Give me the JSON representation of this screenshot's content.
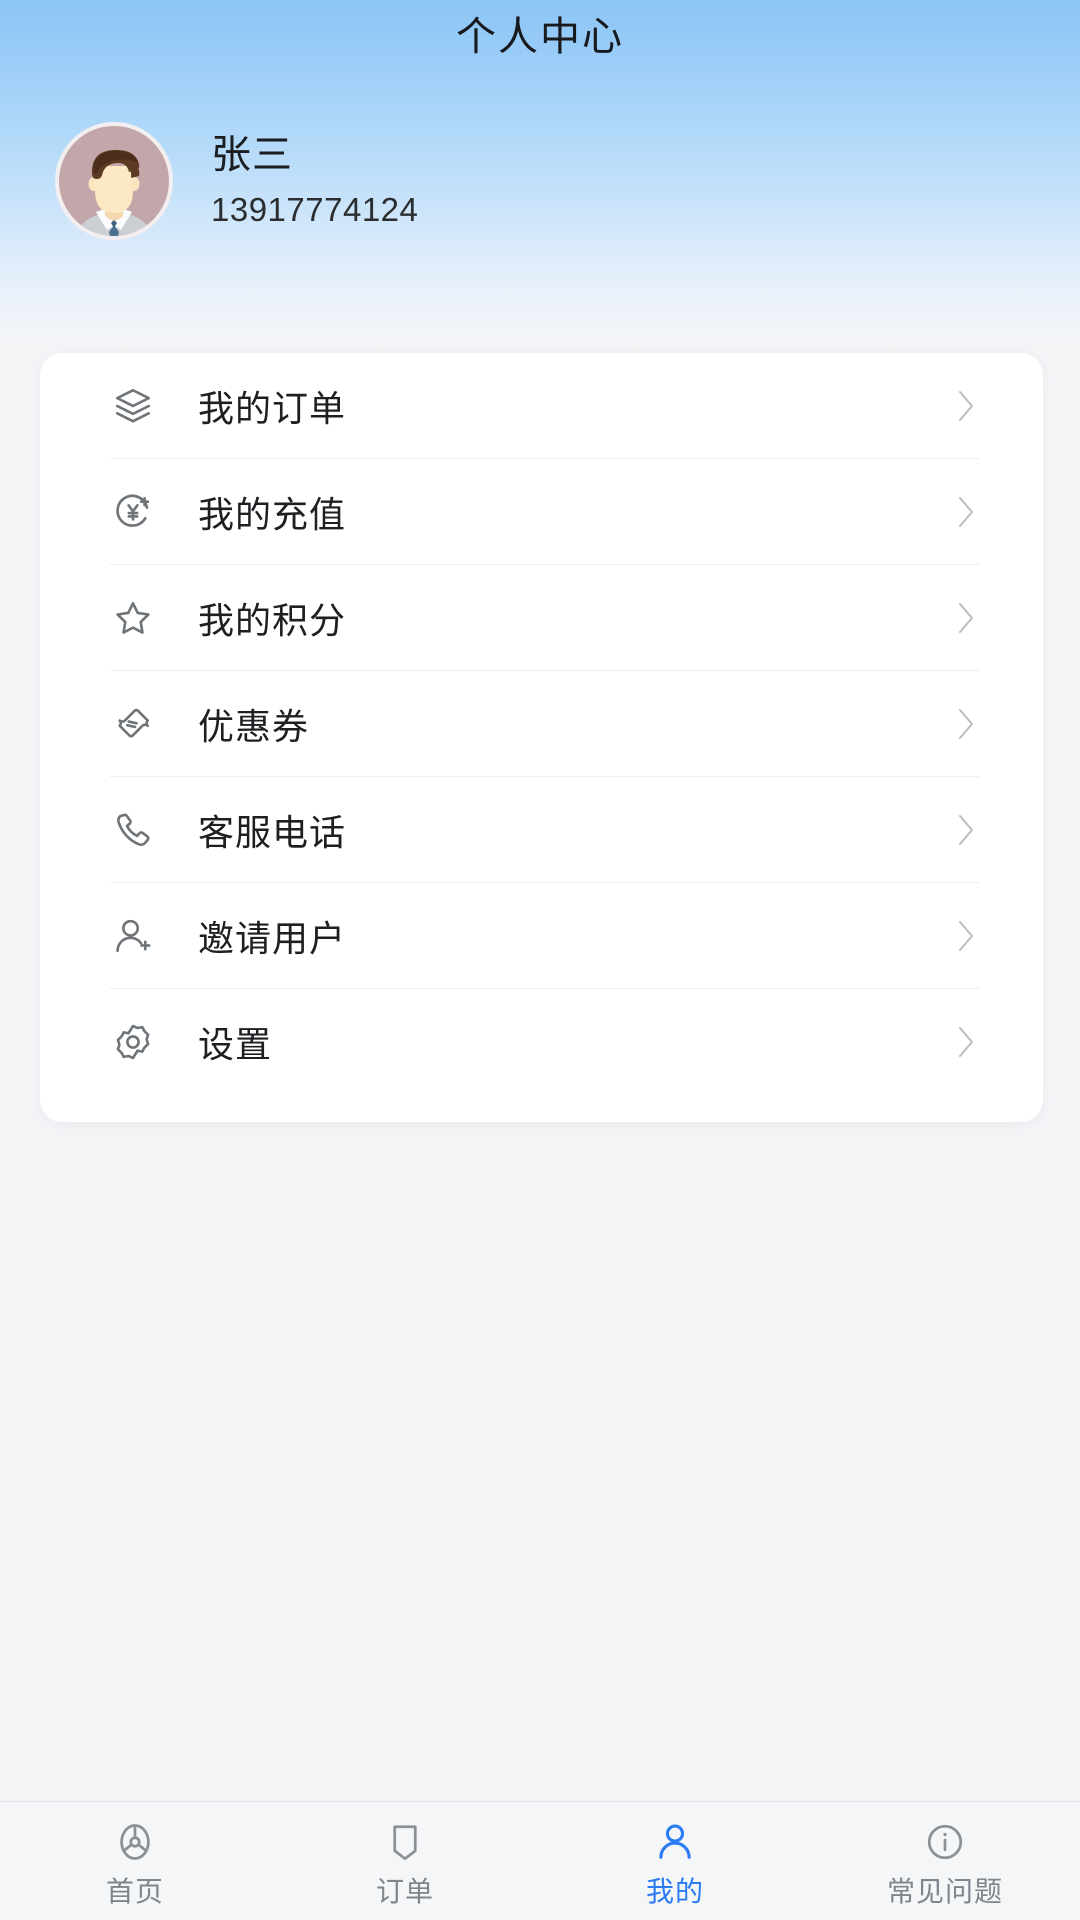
{
  "header": {
    "title": "个人中心",
    "gradient_top": "#8cc5f6",
    "gradient_bottom": "#f4f5f7"
  },
  "profile": {
    "avatar_icon": "user-avatar-male",
    "avatar_bg": "#c2a6a9",
    "name": "张三",
    "phone": "13917774124"
  },
  "menu": {
    "items": [
      {
        "label": "我的订单",
        "icon": "layers-icon",
        "chevron": "chevron-right-icon"
      },
      {
        "label": "我的充值",
        "icon": "currency-recharge-icon",
        "chevron": "chevron-right-icon"
      },
      {
        "label": "我的积分",
        "icon": "star-icon",
        "chevron": "chevron-right-icon"
      },
      {
        "label": "优惠券",
        "icon": "ticket-icon",
        "chevron": "chevron-right-icon"
      },
      {
        "label": "客服电话",
        "icon": "phone-icon",
        "chevron": "chevron-right-icon"
      },
      {
        "label": "邀请用户",
        "icon": "user-plus-icon",
        "chevron": "chevron-right-icon"
      },
      {
        "label": "设置",
        "icon": "gear-icon",
        "chevron": "chevron-right-icon"
      }
    ]
  },
  "tabbar": {
    "active_index": 2,
    "active_color": "#2b7bf5",
    "inactive_color": "#7f858c",
    "items": [
      {
        "label": "首页",
        "icon": "compass-icon"
      },
      {
        "label": "订单",
        "icon": "bookmark-icon"
      },
      {
        "label": "我的",
        "icon": "person-icon"
      },
      {
        "label": "常见问题",
        "icon": "info-circle-icon"
      }
    ]
  }
}
